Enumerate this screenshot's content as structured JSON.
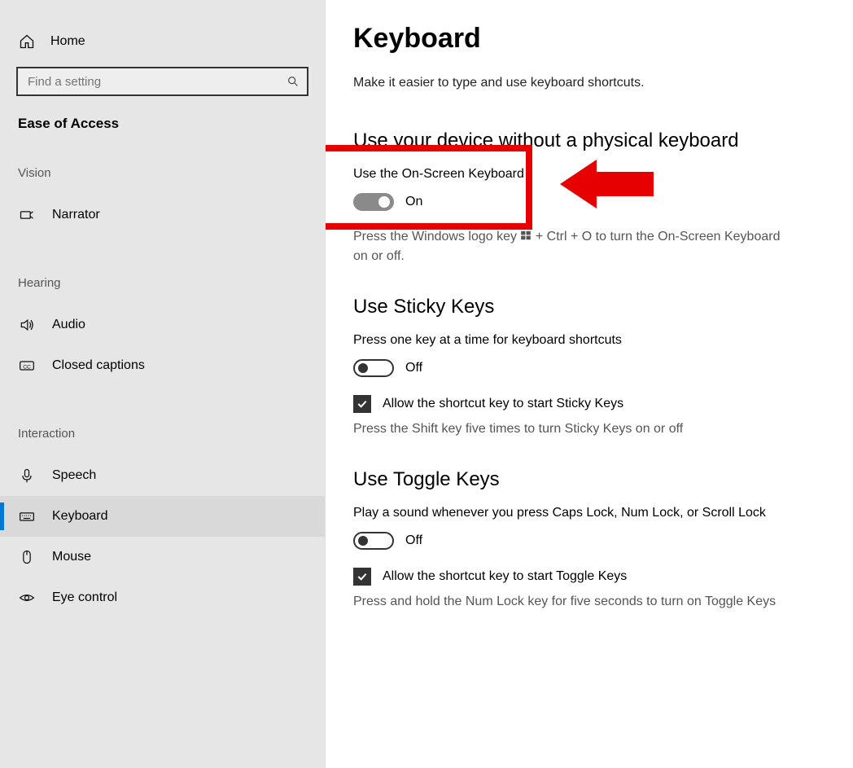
{
  "sidebar": {
    "home": "Home",
    "search_placeholder": "Find a setting",
    "section_title": "Ease of Access",
    "groups": [
      {
        "label": "Vision",
        "items": [
          {
            "key": "narrator",
            "label": "Narrator"
          }
        ]
      },
      {
        "label": "Hearing",
        "items": [
          {
            "key": "audio",
            "label": "Audio"
          },
          {
            "key": "closed-captions",
            "label": "Closed captions"
          }
        ]
      },
      {
        "label": "Interaction",
        "items": [
          {
            "key": "speech",
            "label": "Speech"
          },
          {
            "key": "keyboard",
            "label": "Keyboard",
            "selected": true
          },
          {
            "key": "mouse",
            "label": "Mouse"
          },
          {
            "key": "eye-control",
            "label": "Eye control"
          }
        ]
      }
    ]
  },
  "main": {
    "title": "Keyboard",
    "subtitle": "Make it easier to type and use keyboard shortcuts.",
    "sec1": {
      "heading": "Use your device without a physical keyboard",
      "opt_label": "Use the On-Screen Keyboard",
      "state": "On",
      "hint_pre": "Press the Windows logo key ",
      "hint_post": " + Ctrl + O to turn the On-Screen Keyboard on or off."
    },
    "sec2": {
      "heading": "Use Sticky Keys",
      "opt_label": "Press one key at a time for keyboard shortcuts",
      "state": "Off",
      "check_label": "Allow the shortcut key to start Sticky Keys",
      "hint": "Press the Shift key five times to turn Sticky Keys on or off"
    },
    "sec3": {
      "heading": "Use Toggle Keys",
      "opt_label": "Play a sound whenever you press Caps Lock, Num Lock, or Scroll Lock",
      "state": "Off",
      "check_label": "Allow the shortcut key to start Toggle Keys",
      "hint": "Press and hold the Num Lock key for five seconds to turn on Toggle Keys"
    }
  }
}
